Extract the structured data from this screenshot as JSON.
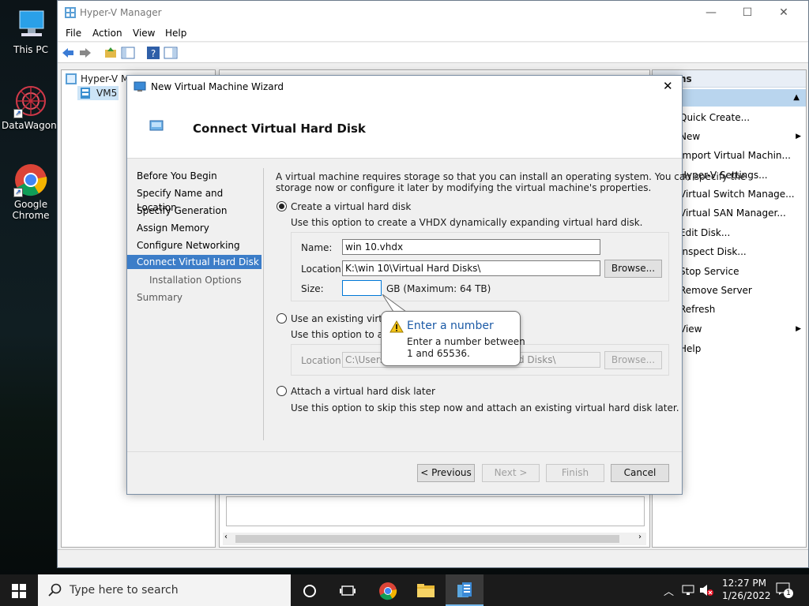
{
  "desktop": {
    "icons": [
      {
        "label": "This PC"
      },
      {
        "label": "DataWagon..."
      },
      {
        "label": "Google Chrome"
      }
    ]
  },
  "hyperv": {
    "title": "Hyper-V Manager",
    "menu": [
      "File",
      "Action",
      "View",
      "Help"
    ],
    "tree": {
      "root": "Hyper-V M",
      "server": "VM5"
    },
    "actions": {
      "header": "ns",
      "items": [
        "Quick Create...",
        "New",
        "Import Virtual Machin...",
        "Hyper-V Settings...",
        "Virtual Switch Manage...",
        "Virtual SAN Manager...",
        "Edit Disk...",
        "Inspect Disk...",
        "Stop Service",
        "Remove Server",
        "Refresh",
        "View",
        "Help"
      ]
    }
  },
  "wizard": {
    "title": "New Virtual Machine Wizard",
    "heading": "Connect Virtual Hard Disk",
    "steps": [
      "Before You Begin",
      "Specify Name and Location",
      "Specify Generation",
      "Assign Memory",
      "Configure Networking",
      "Connect Virtual Hard Disk",
      "Installation Options",
      "Summary"
    ],
    "active_step": "Connect Virtual Hard Disk",
    "intro_line1": "A virtual machine requires storage so that you can install an operating system. You can specify the",
    "intro_line2": "storage now or configure it later by modifying the virtual machine's properties.",
    "create_option": {
      "label": "Create a virtual hard disk",
      "desc": "Use this option to create a VHDX dynamically expanding virtual hard disk.",
      "name_label": "Name:",
      "name_value": "win 10.vhdx",
      "location_label": "Location:",
      "location_value": "K:\\win 10\\Virtual Hard Disks\\",
      "browse_label": "Browse...",
      "size_label": "Size:",
      "size_value": "",
      "size_unit": "GB (Maximum: 64 TB)"
    },
    "existing_option": {
      "label": "Use an existing virtual h",
      "desc": "Use this option to attac",
      "location_label": "Location:",
      "location_value_left": "C:\\Users\\",
      "location_value_right": "d Disks\\",
      "browse_label": "Browse..."
    },
    "later_option": {
      "label": "Attach a virtual hard disk later",
      "desc": "Use this option to skip this step now and attach an existing virtual hard disk later."
    },
    "balloon": {
      "title": "Enter a number",
      "body_line1": "Enter a number between",
      "body_line2": "1 and 65536."
    },
    "buttons": {
      "previous": "< Previous",
      "next": "Next >",
      "finish": "Finish",
      "cancel": "Cancel"
    }
  },
  "taskbar": {
    "search_placeholder": "Type here to search",
    "time": "12:27 PM",
    "date": "1/26/2022",
    "notification_count": "1"
  }
}
